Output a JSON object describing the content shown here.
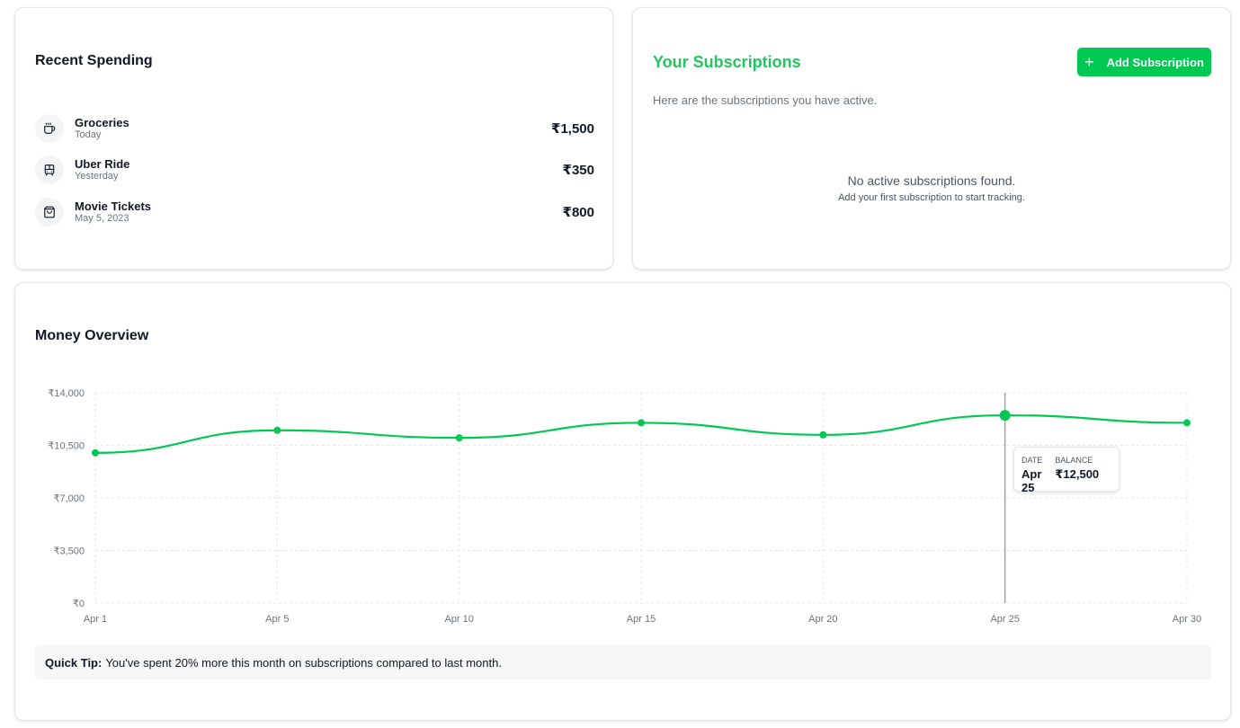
{
  "spending": {
    "title": "Recent Spending",
    "items": [
      {
        "name": "Groceries",
        "date": "Today",
        "amount": "₹1,500",
        "icon": "coffee-cup-icon"
      },
      {
        "name": "Uber Ride",
        "date": "Yesterday",
        "amount": "₹350",
        "icon": "bus-icon"
      },
      {
        "name": "Movie Tickets",
        "date": "May 5, 2023",
        "amount": "₹800",
        "icon": "shopping-bag-icon"
      }
    ]
  },
  "subscriptions": {
    "title": "Your Subscriptions",
    "add_label": "Add Subscription",
    "description": "Here are the subscriptions you have active.",
    "empty_title": "No active subscriptions found.",
    "empty_hint": "Add your first subscription to start tracking."
  },
  "overview": {
    "title": "Money Overview",
    "tooltip": {
      "date_label": "DATE",
      "date_value": "Apr 25",
      "balance_label": "BALANCE",
      "balance_value": "₹12,500"
    },
    "tip_label": "Quick Tip:",
    "tip_text": "You've spent 20% more this month on subscriptions compared to last month."
  },
  "colors": {
    "accent": "#00c853",
    "accent_title": "#22c55e",
    "line": "#00c853"
  },
  "chart_data": {
    "type": "line",
    "x": [
      "Apr 1",
      "Apr 5",
      "Apr 10",
      "Apr 15",
      "Apr 20",
      "Apr 25",
      "Apr 30"
    ],
    "series": [
      {
        "values": [
          10000,
          11500,
          11000,
          12000,
          11200,
          12500,
          12000
        ]
      }
    ],
    "ylim": [
      0,
      14000
    ],
    "yticks": [
      0,
      3500,
      7000,
      10500,
      14000
    ],
    "ytick_labels": [
      "₹0",
      "₹3,500",
      "₹7,000",
      "₹10,500",
      "₹14,000"
    ],
    "grid": true,
    "highlight_index": 5
  }
}
